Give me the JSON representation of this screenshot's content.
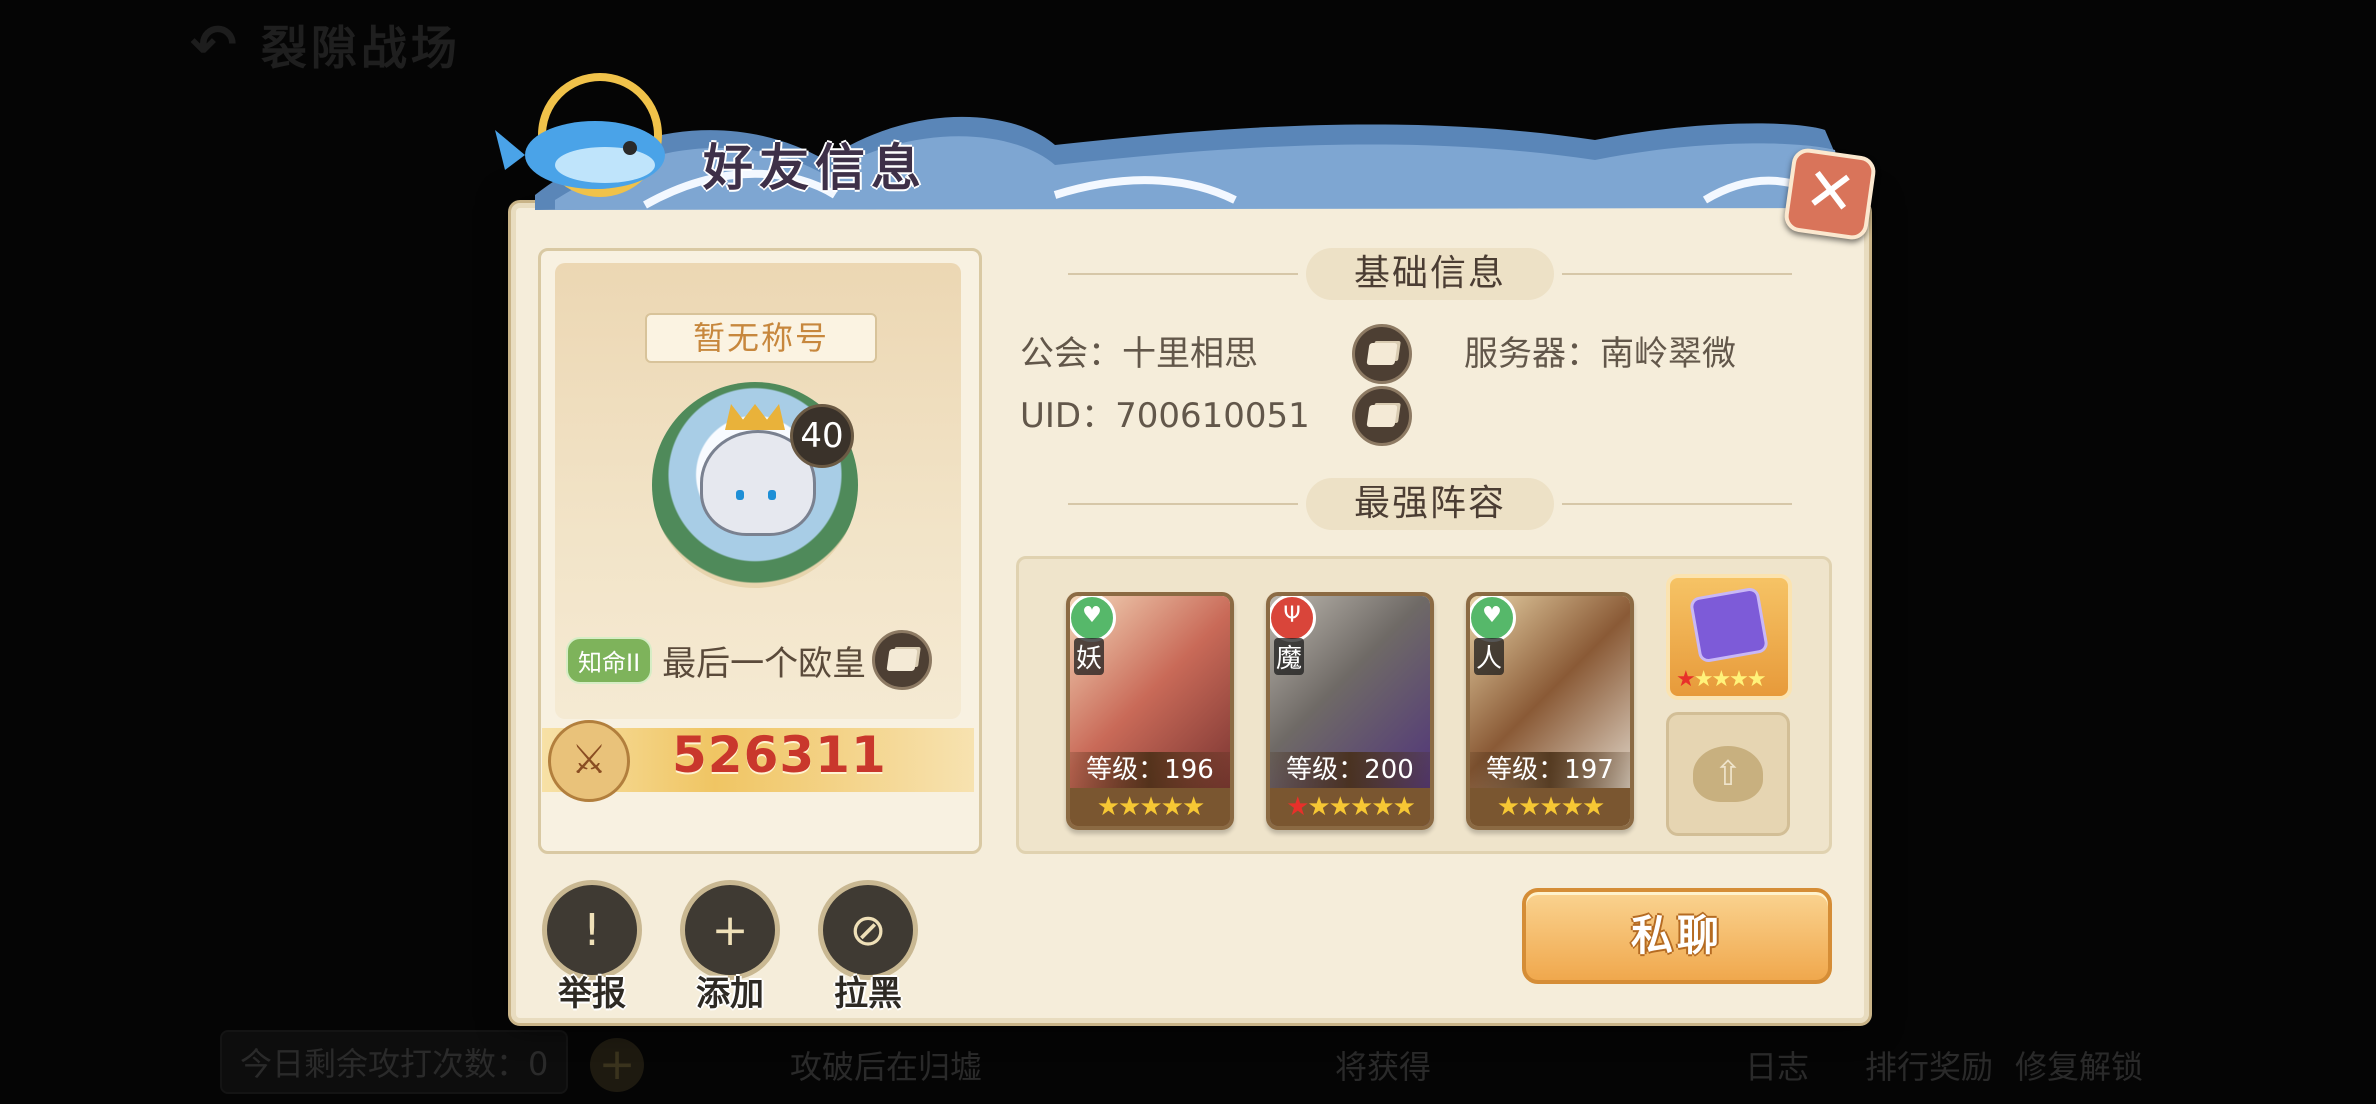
{
  "background": {
    "screen_title": "裂隙战场",
    "remaining_attacks": "今日剩余攻打次数：0",
    "hint_left": "攻破后在归墟",
    "hint_right": "将获得",
    "bottom_buttons": [
      "日志",
      "排行奖励",
      "修复解锁"
    ]
  },
  "dialog": {
    "title": "好友信息",
    "profile": {
      "title_plate": "暂无称号",
      "level": "40",
      "rank_badge": "知命II",
      "player_name": "最后一个欧皇",
      "power": "526311"
    },
    "basic_info": {
      "header": "基础信息",
      "guild": "公会：十里相思",
      "server": "服务器：南岭翠微",
      "uid": "UID：700610051"
    },
    "lineup": {
      "header": "最强阵容",
      "heroes": [
        {
          "race": "妖",
          "level_text": "等级：196",
          "stars": "★★★★★",
          "red_stars": "",
          "faction_color": "#56b86a",
          "faction_icon": "heart-icon"
        },
        {
          "race": "魔",
          "level_text": "等级：200",
          "stars": "★★★★★",
          "red_stars": "★",
          "faction_color": "#d9453a",
          "faction_icon": "trident-icon"
        },
        {
          "race": "人",
          "level_text": "等级：197",
          "stars": "★★★★★",
          "red_stars": "",
          "faction_color": "#56b86a",
          "faction_icon": "heart-icon"
        }
      ],
      "artifact_stars": "★★★★",
      "artifact_red_stars": "★"
    },
    "actions": {
      "report": "举报",
      "add": "添加",
      "block": "拉黑"
    },
    "chat_button": "私聊"
  }
}
